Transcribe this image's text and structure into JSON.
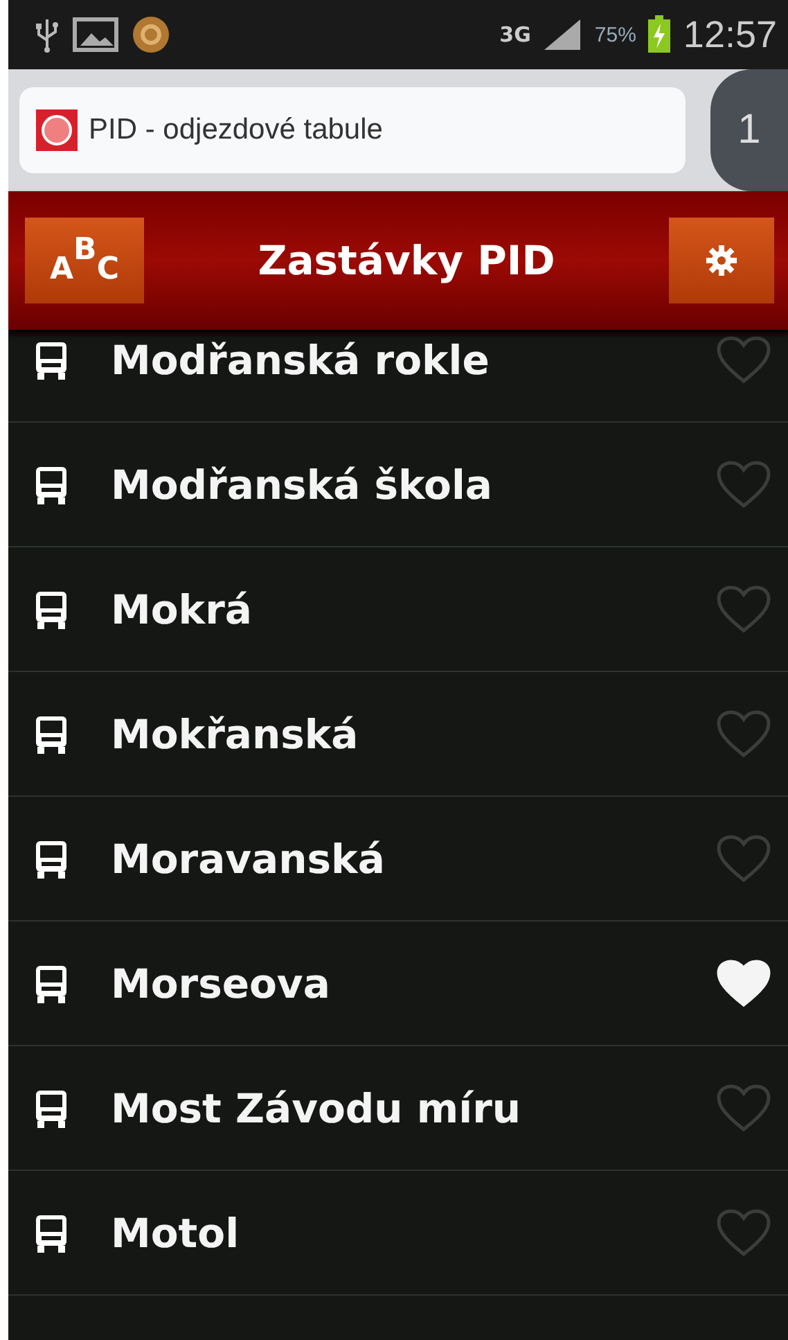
{
  "status_bar": {
    "network": "3G",
    "battery": "75%",
    "time": "12:57"
  },
  "browser": {
    "page_title": "PID - odjezdové tabule",
    "tab_count": "1"
  },
  "header": {
    "title": "Zastávky PID",
    "sort_button": {
      "label": "A$^{B}$C"
    }
  },
  "stops": [
    {
      "name": "Modřanská rokle",
      "favorite": false
    },
    {
      "name": "Modřanská škola",
      "favorite": false
    },
    {
      "name": "Mokrá",
      "favorite": false
    },
    {
      "name": "Mokřanská",
      "favorite": false
    },
    {
      "name": "Moravanská",
      "favorite": false
    },
    {
      "name": "Morseova",
      "favorite": true
    },
    {
      "name": "Most Závodu míru",
      "favorite": false
    },
    {
      "name": "Motol",
      "favorite": false
    }
  ]
}
